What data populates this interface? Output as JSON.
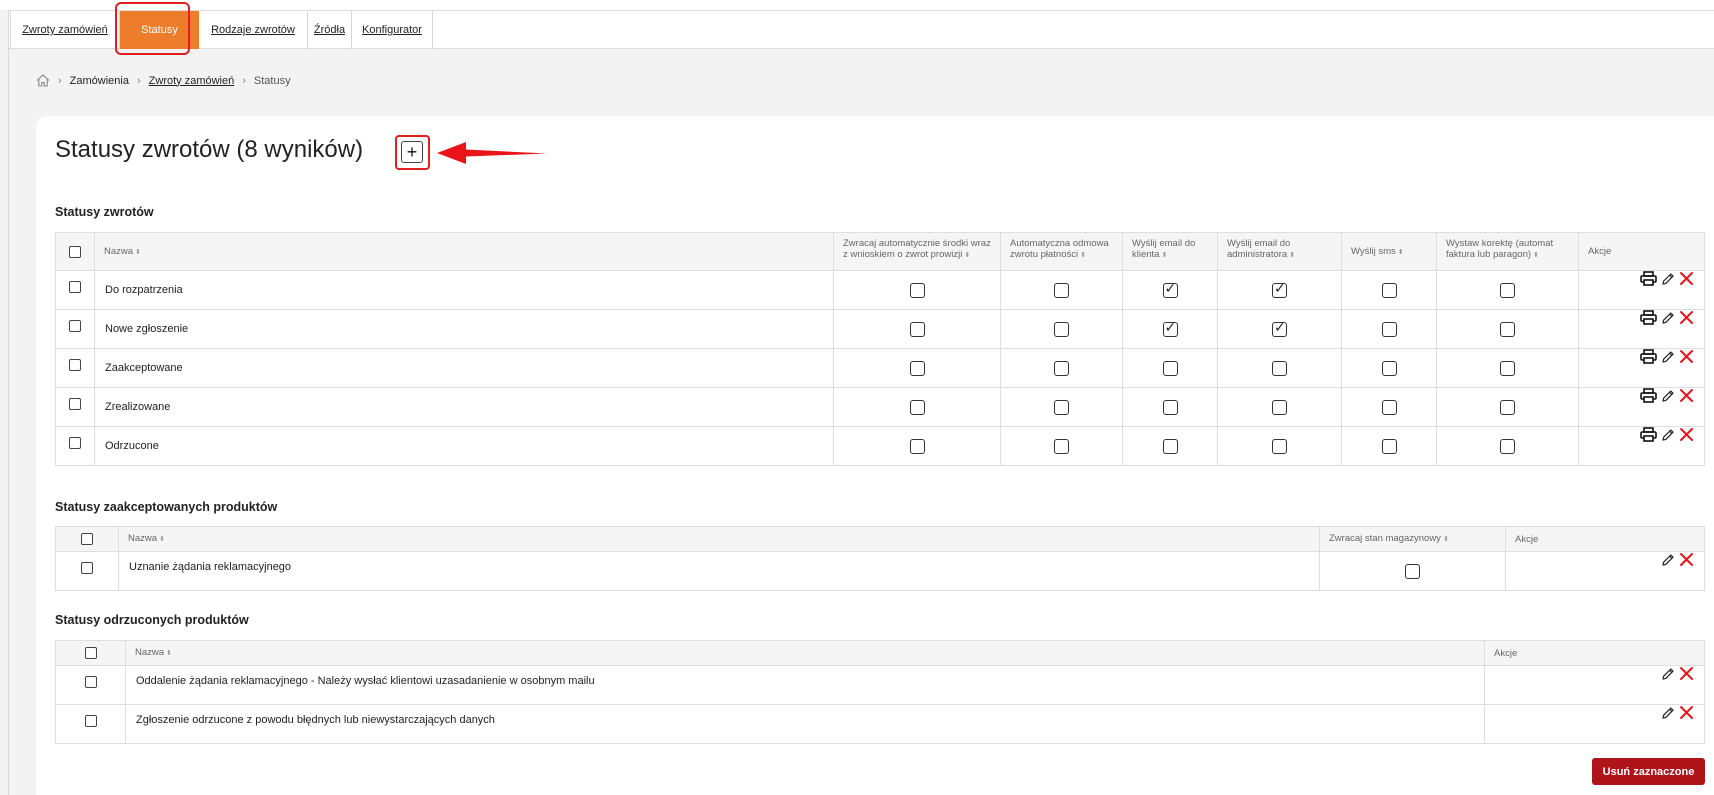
{
  "tabs": [
    {
      "label": "Zwroty zamówień",
      "active": false
    },
    {
      "label": "Statusy",
      "active": true
    },
    {
      "label": "Rodzaje zwrotów",
      "active": false
    },
    {
      "label": "Źródła",
      "active": false
    },
    {
      "label": "Konfigurator",
      "active": false
    }
  ],
  "breadcrumb": {
    "home_icon": "home-icon",
    "items": [
      "Zamówienia",
      "Zwroty zamówień",
      "Statusy"
    ]
  },
  "page": {
    "title": "Statusy zwrotów (8 wyników)",
    "add_label": "+"
  },
  "returns": {
    "title": "Statusy zwrotów",
    "headers": {
      "name": "Nazwa",
      "auto_refund": "Zwracaj automatycznie środki wraz z wnioskiem o zwrot prowizji",
      "auto_reject": "Automatyczna odmowa zwrotu płatności",
      "email_client": "Wyślij email do klienta",
      "email_admin": "Wyślij email do administratora",
      "sms": "Wyślij sms",
      "correction": "Wystaw korektę (automat faktura lub paragon)",
      "actions": "Akcje"
    },
    "rows": [
      {
        "name": "Do rozpatrzenia",
        "auto_refund": false,
        "auto_reject": false,
        "email_client": true,
        "email_admin": true,
        "sms": false,
        "correction": false
      },
      {
        "name": "Nowe zgłoszenie",
        "auto_refund": false,
        "auto_reject": false,
        "email_client": true,
        "email_admin": true,
        "sms": false,
        "correction": false
      },
      {
        "name": "Zaakceptowane",
        "auto_refund": false,
        "auto_reject": false,
        "email_client": false,
        "email_admin": false,
        "sms": false,
        "correction": false
      },
      {
        "name": "Zrealizowane",
        "auto_refund": false,
        "auto_reject": false,
        "email_client": false,
        "email_admin": false,
        "sms": false,
        "correction": false
      },
      {
        "name": "Odrzucone",
        "auto_refund": false,
        "auto_reject": false,
        "email_client": false,
        "email_admin": false,
        "sms": false,
        "correction": false
      }
    ]
  },
  "accepted": {
    "title": "Statusy zaakceptowanych produktów",
    "headers": {
      "name": "Nazwa",
      "stock": "Zwracaj stan magazynowy",
      "actions": "Akcje"
    },
    "rows": [
      {
        "name": "Uznanie żądania reklamacyjnego",
        "stock": false
      }
    ]
  },
  "rejected": {
    "title": "Statusy odrzuconych produktów",
    "headers": {
      "name": "Nazwa",
      "actions": "Akcje"
    },
    "rows": [
      {
        "name": "Oddalenie żądania reklamacyjnego - Należy wysłać klientowi uzasadanienie w osobnym mailu"
      },
      {
        "name": "Zgłoszenie odrzucone z powodu błędnych lub niewystarczających danych"
      }
    ]
  },
  "delete_selected_label": "Usuń zaznaczone",
  "colors": {
    "accent": "#ee7d2b",
    "highlight": "#e02020",
    "danger": "#b0141b"
  }
}
